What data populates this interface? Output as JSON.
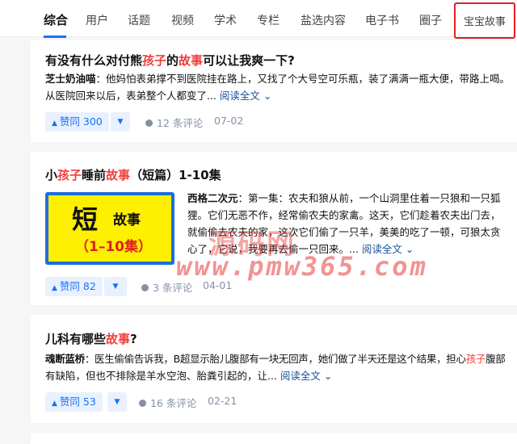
{
  "nav": {
    "tabs": [
      {
        "label": "综合",
        "active": true
      },
      {
        "label": "用户"
      },
      {
        "label": "话题"
      },
      {
        "label": "视频"
      },
      {
        "label": "学术"
      },
      {
        "label": "专栏"
      },
      {
        "label": "盐选内容"
      },
      {
        "label": "电子书"
      },
      {
        "label": "圈子"
      },
      {
        "label": "宝宝故事"
      }
    ]
  },
  "results": [
    {
      "title": {
        "a": "有没有什么对付熊",
        "hl1": "孩子",
        "b": "的",
        "hl2": "故事",
        "c": "可以让我爽一下?"
      },
      "author": "芝士奶油喵",
      "excerpt_line1": "他妈怕表弟撑不到医院挂在路上，又找了个大号空可乐瓶，装了满满一瓶大便，带路上喝。",
      "excerpt_line2": "从医院回来以后，表弟整个人都变了...",
      "read_more": "阅读全文",
      "vote_label": "赞同 300",
      "comments": "12 条评论",
      "date": "07-02"
    },
    {
      "title": {
        "a": "小",
        "hl1": "孩子",
        "b": "睡前",
        "hl2": "故事",
        "c": "（短篇）1-10集"
      },
      "thumb": {
        "big": "短",
        "small": "故事",
        "sub": "（1–10集）"
      },
      "author": "西格二次元",
      "excerpt_line1": "第一集：农夫和狼从前，一个山洞里住着一只狼和一只狐",
      "excerpt_line2": "狸。它们无恶不作，经常偷农夫的家禽。这天，它们趁着农夫出门去，",
      "excerpt_line3": "就偷偷去农夫的家，这次它们偷了一只羊，美美的吃了一顿，可狼太贪",
      "excerpt_line4": "心了，它说，我要再去偷一只回来。...",
      "read_more": "阅读全文",
      "vote_label": "赞同 82",
      "comments": "3 条评论",
      "date": "04-01"
    },
    {
      "title": {
        "a": "儿科有哪些",
        "hl2": "故事",
        "c": "?"
      },
      "author": "魂断蓝桥",
      "excerpt_line1a": "医生偷偷告诉我，B超显示胎儿腹部有一块无回声，她们做了半天还是这个结果，担心",
      "excerpt_hl": "孩子",
      "excerpt_line1b": "腹部",
      "excerpt_line2": "有缺陷，但也不排除是羊水空泡、胎粪引起的，让...",
      "read_more": "阅读全文",
      "vote_label": "赞同 53",
      "comments": "16 条评论",
      "date": "02-21"
    }
  ],
  "watermark": {
    "top": "源码网",
    "url": "www.pmw365.com"
  },
  "colors": {
    "accent": "#1772f6",
    "highlight": "#f1403c",
    "meta": "#8590a6",
    "link": "#175199",
    "marker": "#e02020"
  }
}
